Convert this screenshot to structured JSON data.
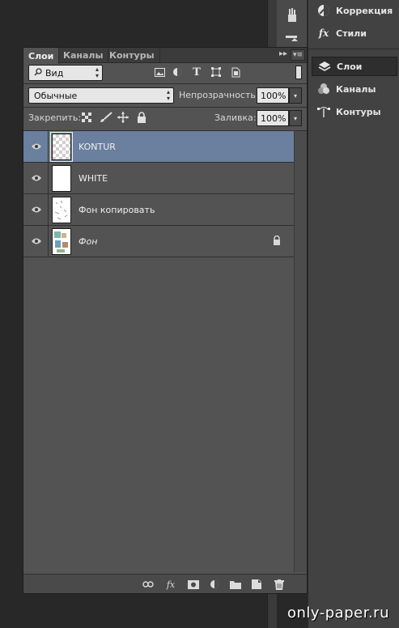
{
  "dock": {
    "items": [
      {
        "label": "Коррекция",
        "icon": "adjustments-icon"
      },
      {
        "label": "Стили",
        "icon": "styles-fx-icon"
      },
      {
        "label": "Слои",
        "icon": "layers-icon",
        "active": true
      },
      {
        "label": "Каналы",
        "icon": "channels-icon"
      },
      {
        "label": "Контуры",
        "icon": "paths-icon"
      }
    ]
  },
  "panel": {
    "tabs": [
      "Слои",
      "Каналы",
      "Контуры"
    ],
    "filter": {
      "label": "Вид"
    },
    "blend_mode": "Обычные",
    "opacity_label": "Непрозрачность:",
    "opacity_value": "100%",
    "lock_label": "Закрепить:",
    "fill_label": "Заливка:",
    "fill_value": "100%"
  },
  "layers": [
    {
      "name": "KONTUR",
      "selected": true,
      "thumb": "transparent"
    },
    {
      "name": "WHITE",
      "selected": false,
      "thumb": "white"
    },
    {
      "name": "Фон копировать",
      "selected": false,
      "thumb": "sketch"
    },
    {
      "name": "Фон",
      "selected": false,
      "thumb": "image",
      "locked": true,
      "italic": true
    }
  ],
  "watermark": "only-paper.ru",
  "colors": {
    "panel_bg": "#535353",
    "selected_row": "#6b7f9e",
    "dock_bg": "#424242",
    "workspace_bg": "#282828"
  }
}
